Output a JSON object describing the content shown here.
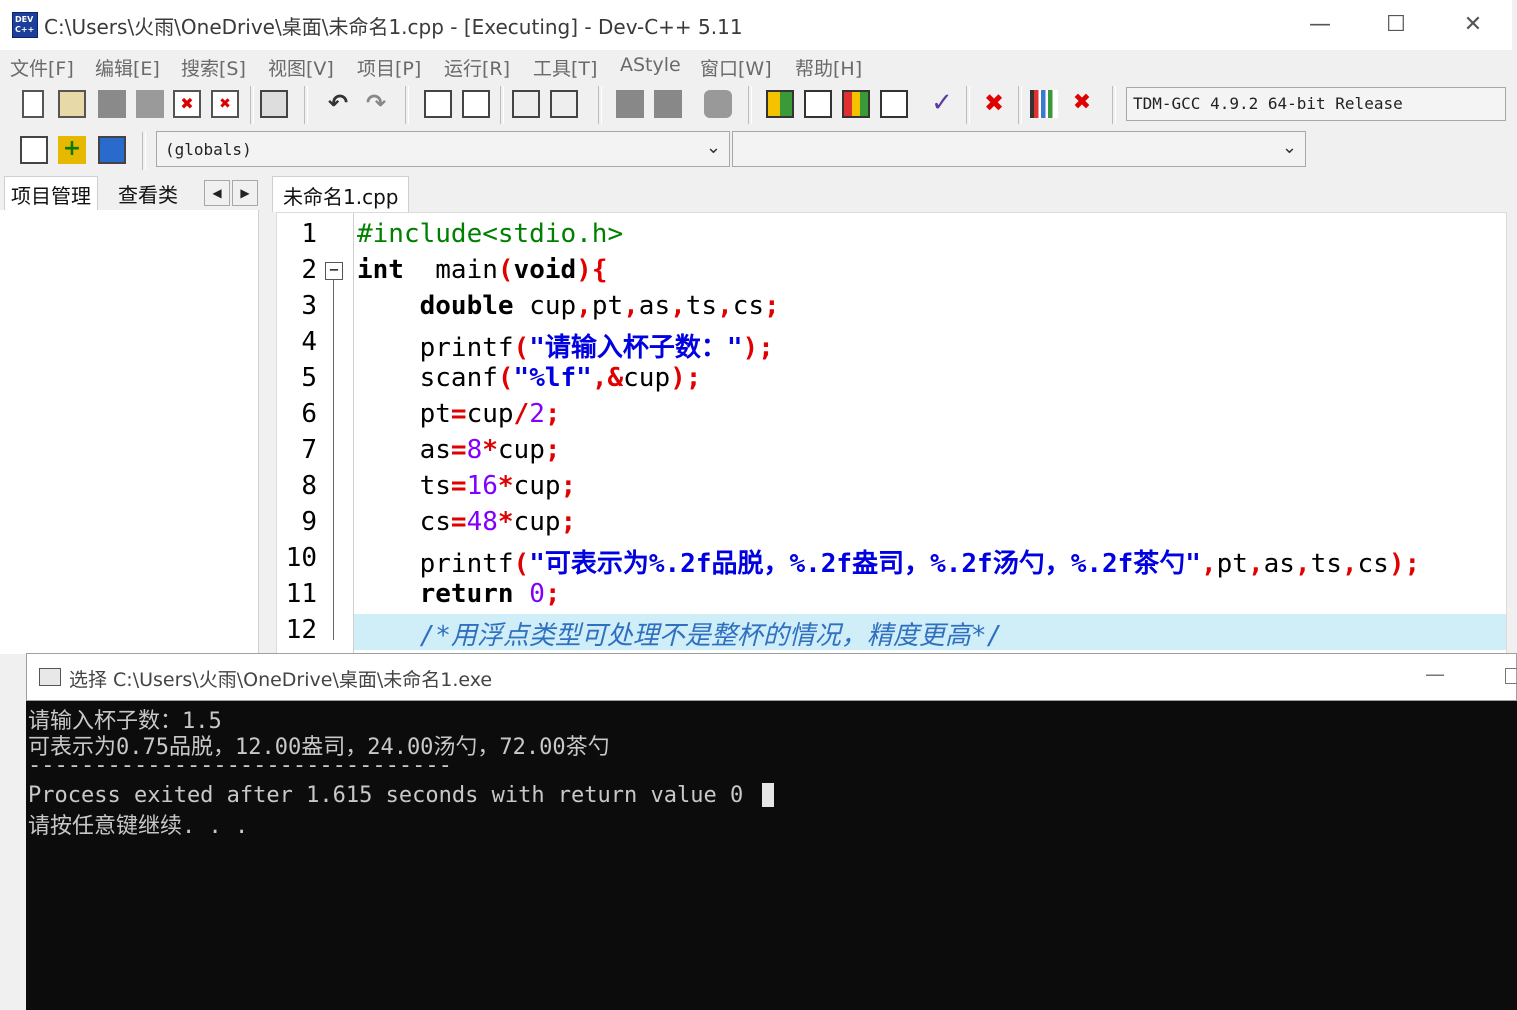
{
  "window": {
    "title": "C:\\Users\\火雨\\OneDrive\\桌面\\未命名1.cpp - [Executing] - Dev-C++ 5.11",
    "app_icon_text": "DEV C++"
  },
  "menu": [
    "文件[F]",
    "编辑[E]",
    "搜索[S]",
    "视图[V]",
    "项目[P]",
    "运行[R]",
    "工具[T]",
    "AStyle",
    "窗口[W]",
    "帮助[H]"
  ],
  "toolbar": {
    "compiler": "TDM-GCC 4.9.2 64-bit Release"
  },
  "toolbar2": {
    "scope_combo": "(globals)",
    "member_combo": ""
  },
  "left_panel": {
    "tabs": [
      "项目管理",
      "查看类"
    ]
  },
  "editor": {
    "tab_label": "未命名1.cpp",
    "line_numbers": [
      "1",
      "2",
      "3",
      "4",
      "5",
      "6",
      "7",
      "8",
      "9",
      "10",
      "11",
      "12"
    ],
    "highlighted_line": 12
  },
  "console": {
    "title": "选择 C:\\Users\\火雨\\OneDrive\\桌面\\未命名1.exe",
    "lines": [
      "请输入杯子数：1.5",
      "可表示为0.75品脱，12.00盎司，24.00汤勺，72.00茶勺",
      "--------------------------------",
      "Process exited after 1.615 seconds with return value 0",
      "请按任意键继续. . ."
    ]
  },
  "colors": {
    "keyword": "#000000",
    "preprocessor": "#008000",
    "symbol": "#e00000",
    "string": "#0000e0",
    "number": "#8000ff",
    "comment": "#3070c0",
    "current_line": "#cfeef8",
    "console_bg": "#0c0c0c"
  }
}
